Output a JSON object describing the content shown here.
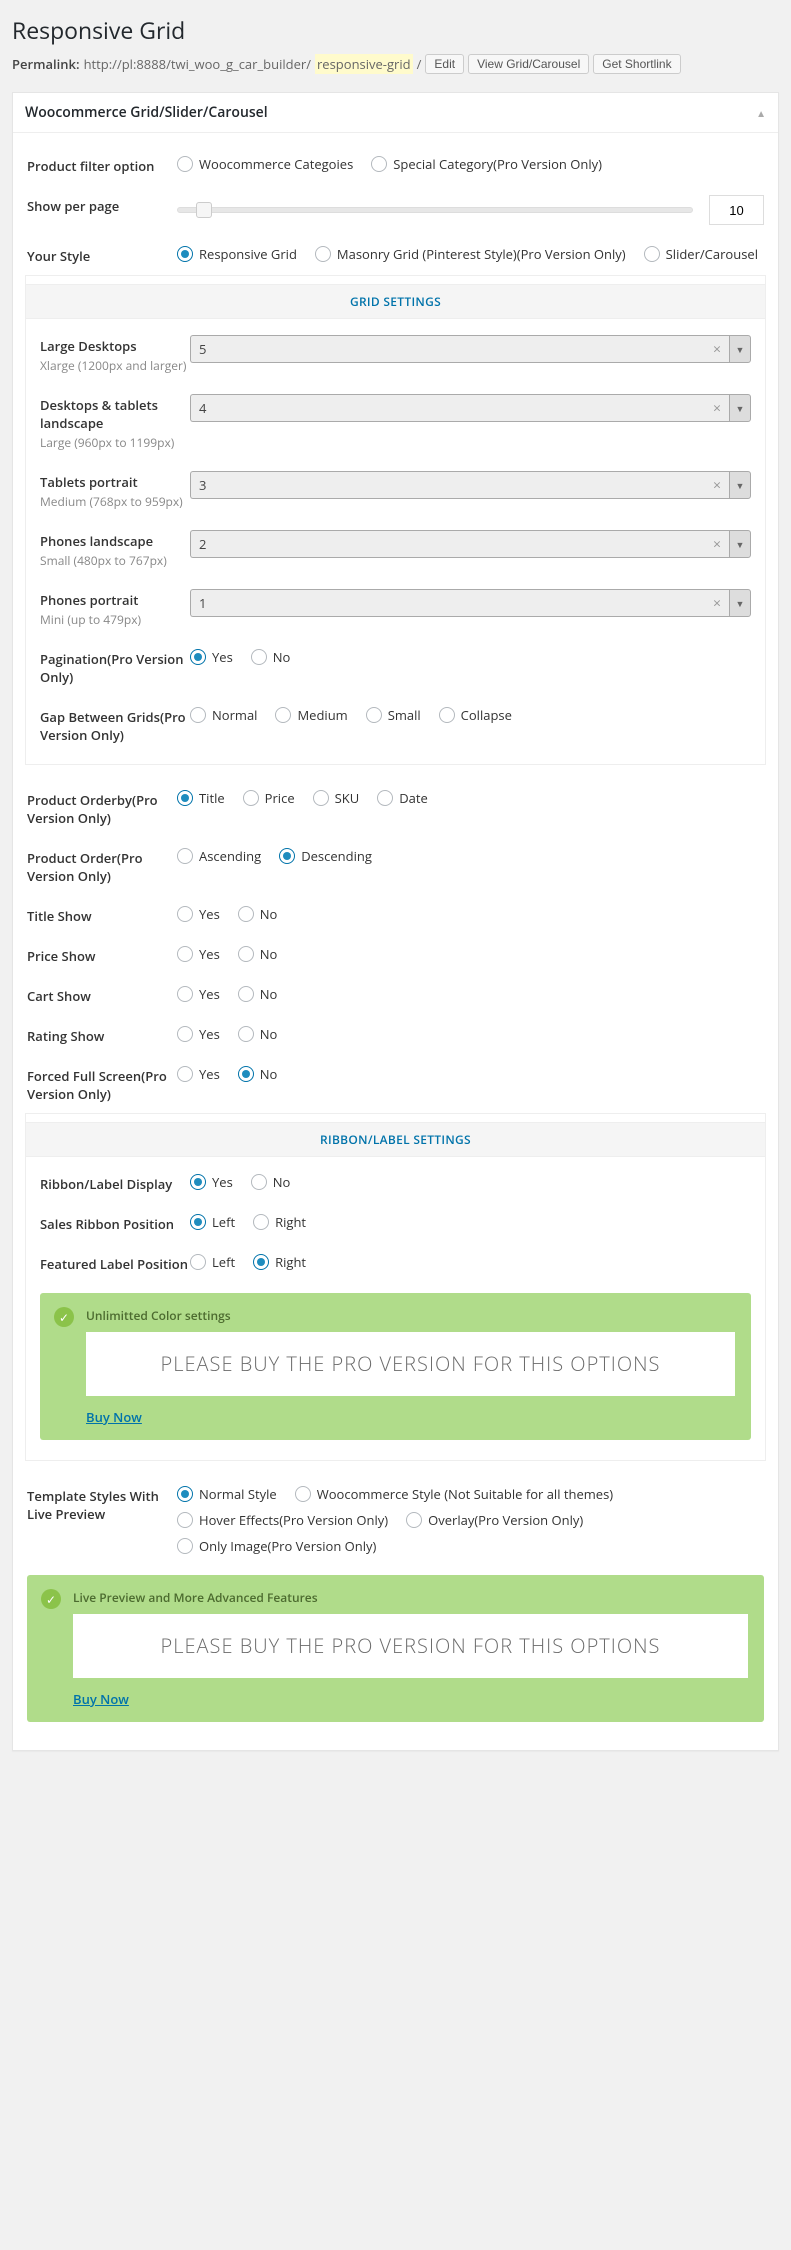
{
  "page_title": "Responsive Grid",
  "permalink": {
    "label": "Permalink:",
    "base": "http://pl:8888/twi_woo_g_car_builder/",
    "slug": "responsive-grid",
    "trail": "/",
    "edit": "Edit",
    "view": "View Grid/Carousel",
    "shortlink": "Get Shortlink"
  },
  "metabox_title": "Woocommerce Grid/Slider/Carousel",
  "rows": {
    "product_filter": {
      "label": "Product filter option",
      "opts": [
        "Woocommerce Categoies",
        "Special Category(Pro Version Only)"
      ],
      "selected": -1
    },
    "show_per_page": {
      "label": "Show per page",
      "value": "10"
    },
    "your_style": {
      "label": "Your Style",
      "opts": [
        "Responsive Grid",
        "Masonry Grid (Pinterest Style)(Pro Version Only)",
        "Slider/Carousel"
      ],
      "selected": 0
    }
  },
  "grid_settings": {
    "heading": "GRID SETTINGS",
    "large_desktops": {
      "label": "Large Desktops",
      "sub": "Xlarge (1200px and larger)",
      "value": "5"
    },
    "desktops_tablets": {
      "label": "Desktops & tablets landscape",
      "sub": "Large (960px to 1199px)",
      "value": "4"
    },
    "tablets_portrait": {
      "label": "Tablets portrait",
      "sub": "Medium (768px to 959px)",
      "value": "3"
    },
    "phones_landscape": {
      "label": "Phones landscape",
      "sub": "Small (480px to 767px)",
      "value": "2"
    },
    "phones_portrait": {
      "label": "Phones portrait",
      "sub": "Mini (up to 479px)",
      "value": "1"
    },
    "pagination": {
      "label": "Pagination(Pro Version Only)",
      "opts": [
        "Yes",
        "No"
      ],
      "selected": 0
    },
    "gap": {
      "label": "Gap Between Grids(Pro Version Only)",
      "opts": [
        "Normal",
        "Medium",
        "Small",
        "Collapse"
      ],
      "selected": -1
    }
  },
  "orderby": {
    "label": "Product Orderby(Pro Version Only)",
    "opts": [
      "Title",
      "Price",
      "SKU",
      "Date"
    ],
    "selected": 0
  },
  "order": {
    "label": "Product Order(Pro Version Only)",
    "opts": [
      "Ascending",
      "Descending"
    ],
    "selected": 1
  },
  "title_show": {
    "label": "Title Show",
    "opts": [
      "Yes",
      "No"
    ],
    "selected": -1
  },
  "price_show": {
    "label": "Price Show",
    "opts": [
      "Yes",
      "No"
    ],
    "selected": -1
  },
  "cart_show": {
    "label": "Cart Show",
    "opts": [
      "Yes",
      "No"
    ],
    "selected": -1
  },
  "rating_show": {
    "label": "Rating Show",
    "opts": [
      "Yes",
      "No"
    ],
    "selected": -1
  },
  "forced_full": {
    "label": "Forced Full Screen(Pro Version Only)",
    "opts": [
      "Yes",
      "No"
    ],
    "selected": 1
  },
  "ribbon": {
    "heading": "RIBBON/LABEL SETTINGS",
    "display": {
      "label": "Ribbon/Label Display",
      "opts": [
        "Yes",
        "No"
      ],
      "selected": 0
    },
    "sales_pos": {
      "label": "Sales Ribbon Position",
      "opts": [
        "Left",
        "Right"
      ],
      "selected": 0
    },
    "featured_pos": {
      "label": "Featured Label Position",
      "opts": [
        "Left",
        "Right"
      ],
      "selected": 1
    }
  },
  "promo1": {
    "title": "Unlimitted Color settings",
    "body": "PLEASE BUY THE PRO VERSION FOR THIS OPTIONS",
    "link": "Buy Now"
  },
  "template_styles": {
    "label": "Template Styles With Live Preview",
    "opts": [
      "Normal Style",
      "Woocommerce Style (Not Suitable for all themes)",
      "Hover Effects(Pro Version Only)",
      "Overlay(Pro Version Only)",
      "Only Image(Pro Version Only)"
    ],
    "selected": 0
  },
  "promo2": {
    "title": "Live Preview and More Advanced Features",
    "body": "PLEASE BUY THE PRO VERSION FOR THIS OPTIONS",
    "link": "Buy Now"
  }
}
